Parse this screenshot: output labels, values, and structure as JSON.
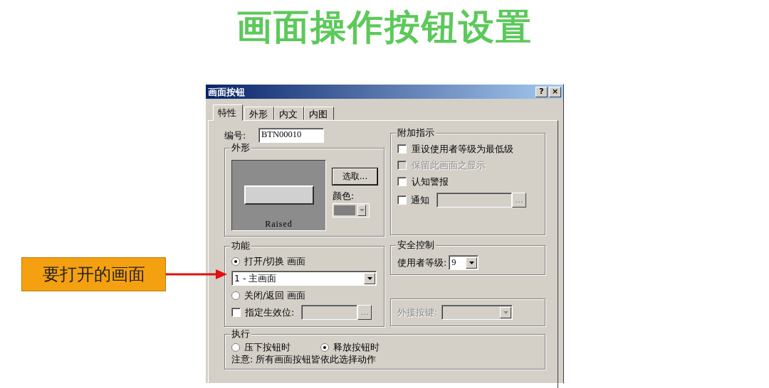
{
  "slide_title": "画面操作按钮设置",
  "callout": {
    "text": "要打开的画面"
  },
  "dialog": {
    "title": "画面按钮",
    "help_button": "?",
    "close_button": "×",
    "tabs": [
      {
        "label": "特性",
        "selected": true
      },
      {
        "label": "外形",
        "selected": false
      },
      {
        "label": "内文",
        "selected": false
      },
      {
        "label": "内图",
        "selected": false
      }
    ],
    "id_field": {
      "label": "编号:",
      "value": "BTN00010"
    },
    "appearance": {
      "legend": "外形",
      "preview_label": "Raised",
      "select_button": "选取...",
      "color_label": "颜色:"
    },
    "indicators": {
      "legend": "附加指示",
      "items": [
        {
          "kind": "check",
          "label": "重设使用者等级为最低级",
          "checked": false,
          "disabled": false
        },
        {
          "kind": "check",
          "label": "保留此画面之显示",
          "checked": false,
          "disabled": true
        },
        {
          "kind": "check",
          "label": "认知警报",
          "checked": false,
          "disabled": false
        },
        {
          "kind": "check-field",
          "label": "通知",
          "checked": false,
          "disabled": false,
          "browse": "..."
        }
      ]
    },
    "function": {
      "legend": "功能",
      "items": [
        {
          "kind": "radio",
          "label": "打开/切换 画面",
          "selected": true
        },
        {
          "kind": "select",
          "value": "1 - 主画面"
        },
        {
          "kind": "radio",
          "label": "关闭/返回 画面",
          "selected": false
        },
        {
          "kind": "check-field",
          "label": "指定生效位:",
          "checked": false,
          "browse": "..."
        }
      ]
    },
    "security": {
      "legend": "安全控制",
      "label": "使用者等级:",
      "value": "9"
    },
    "external_key": {
      "label": "外接按键:",
      "disabled": true
    },
    "execute": {
      "legend": "执行",
      "options": [
        {
          "label": "压下按钮时",
          "selected": false
        },
        {
          "label": "释放按钮时",
          "selected": true
        }
      ],
      "note": "注意: 所有画面按钮皆依此选择动作"
    }
  }
}
